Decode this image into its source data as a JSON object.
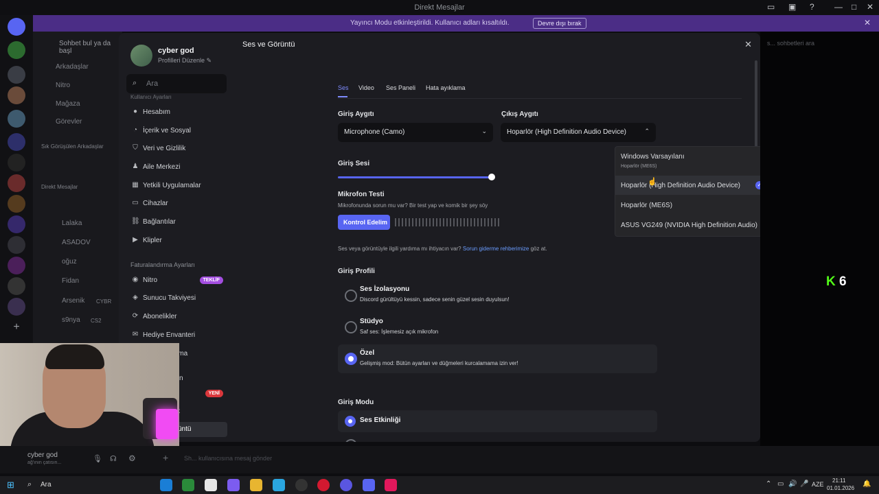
{
  "window": {
    "title": "Direkt Mesajlar"
  },
  "banner": {
    "text": "Yayıncı Modu etkinleştirildi. Kullanıcı adları kısaltıldı.",
    "button": "Devre dışı bırak"
  },
  "dm_column": {
    "search": "Sohbet bul ya da başl",
    "items": [
      "Arkadaşlar",
      "Nitro",
      "Mağaza",
      "Görevler"
    ],
    "recent_header": "Sık Görüşülen Arkadaşlar",
    "dm_header": "Direkt Mesajlar",
    "dms": [
      "Lalaka",
      "ASADOV",
      "oğuz",
      "Fidan",
      "Arsenik",
      "s9nya"
    ],
    "dm_tags": [
      "CYBR",
      "CS2"
    ],
    "right_search": "s... sohbetleri ara"
  },
  "profile": {
    "name": "cyber god",
    "edit": "Profilleri Düzenle"
  },
  "sidebar": {
    "search_placeholder": "Ara",
    "section_user": "Kullanıcı Ayarları",
    "user_items": [
      {
        "label": "Hesabım",
        "icon": "person-icon"
      },
      {
        "label": "İçerik ve Sosyal",
        "icon": "chat-icon"
      },
      {
        "label": "Veri ve Gizlilik",
        "icon": "shield-icon"
      },
      {
        "label": "Aile Merkezi",
        "icon": "family-icon"
      },
      {
        "label": "Yetkili Uygulamalar",
        "icon": "apps-icon"
      },
      {
        "label": "Cihazlar",
        "icon": "devices-icon"
      },
      {
        "label": "Bağlantılar",
        "icon": "link-icon"
      },
      {
        "label": "Klipler",
        "icon": "clip-icon"
      }
    ],
    "section_billing": "Faturalandırma Ayarları",
    "billing_items": [
      {
        "label": "Nitro",
        "icon": "nitro-icon",
        "badge": "TEKLİF"
      },
      {
        "label": "Sunucu Takviyesi",
        "icon": "boost-icon"
      },
      {
        "label": "Abonelikler",
        "icon": "subscription-icon"
      },
      {
        "label": "Hediye Envanteri",
        "icon": "gift-icon"
      }
    ],
    "partial_items": [
      "rma",
      "n",
      "k",
      "üntü"
    ],
    "new_badge": "YENİ"
  },
  "settings": {
    "title": "Ses ve Görüntü",
    "tabs": [
      "Ses",
      "Video",
      "Ses Paneli",
      "Hata ayıklama"
    ],
    "input_device_label": "Giriş Aygıtı",
    "input_device": "Microphone (Camo)",
    "output_device_label": "Çıkış Aygıtı",
    "output_device": "Hoparlör (High Definition Audio Device)",
    "menu_options": [
      {
        "label": "Windows Varsayılanı",
        "sub": "Hoparlör (ME6S)"
      },
      {
        "label": "Hoparlör (High Definition Audio Device)",
        "selected": true
      },
      {
        "label": "Hoparlör (ME6S)"
      },
      {
        "label": "ASUS VG249 (NVIDIA High Definition Audio)"
      }
    ],
    "input_volume_label": "Giriş Sesi",
    "input_volume": 1.0,
    "mic_test_title": "Mikrofon Testi",
    "mic_test_desc": "Mikrofonunda sorun mu var? Bir test yap ve komik bir şey söy",
    "mic_test_button": "Kontrol Edelim",
    "help_text": "Ses veya görüntüyle ilgili yardıma mı ihtiyacın var?",
    "help_link": "Sorun giderme rehberimize",
    "help_tail": "göz at.",
    "input_profile_title": "Giriş Profili",
    "profiles": [
      {
        "title": "Ses İzolasyonu",
        "desc": "Discord gürültüyü kessin, sadece senin güzel sesin duyulsun!",
        "selected": false
      },
      {
        "title": "Stüdyo",
        "desc": "Saf ses: İşlemesiz açık mikrofon",
        "selected": false
      },
      {
        "title": "Özel",
        "desc": "Gelişmiş mod: Bütün ayarları ve düğmeleri kurcalamama izin ver!",
        "selected": true
      }
    ],
    "input_mode_title": "Giriş Modu",
    "input_mode_option": "Ses Etkinliği"
  },
  "user_bar": {
    "name": "cyber god",
    "status": "ağ'ının çatısın...",
    "message_placeholder": "Sh... kullanıcısına mesaj gönder"
  },
  "overlay": {
    "text": "6"
  },
  "taskbar": {
    "search": "Ara",
    "lang": "AZE",
    "time": "21:11",
    "date": "01.01.2026"
  },
  "colors": {
    "accent": "#5865f2",
    "banner": "#4b2d86",
    "badge": "#a34ee0",
    "link": "#6a9cff"
  }
}
